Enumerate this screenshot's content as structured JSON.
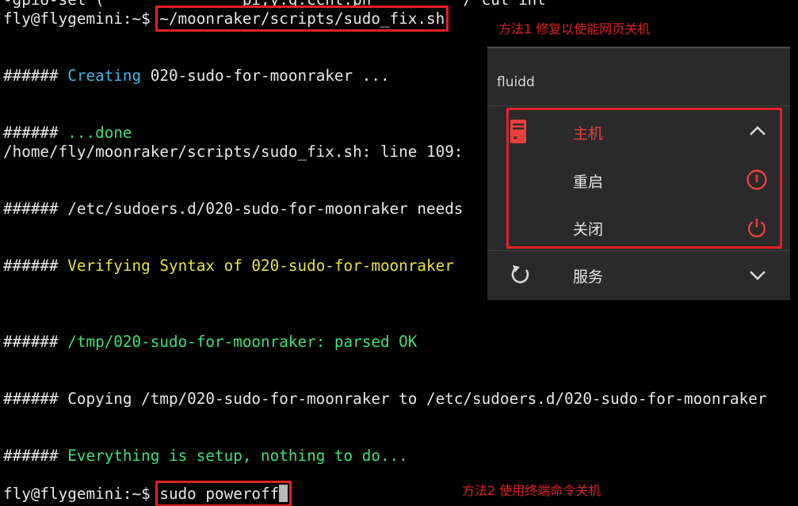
{
  "terminal": {
    "lines": [
      {
        "parts": [
          {
            "t": "-gpio-set (               pi,y.g.ccnt.pn          / cut int",
            "c": "white"
          }
        ]
      },
      {
        "parts": [
          {
            "t": "fly@flygemini:~$ ",
            "c": "white"
          },
          {
            "t": "~/moonraker/scripts/sudo_fix.sh",
            "c": "white",
            "box": true
          }
        ]
      },
      {
        "parts": []
      },
      {
        "parts": []
      },
      {
        "parts": [
          {
            "t": "###### ",
            "c": "white"
          },
          {
            "t": "Creating",
            "c": "cyan"
          },
          {
            "t": " 020-sudo-for-moonraker ...",
            "c": "white"
          }
        ]
      },
      {
        "parts": []
      },
      {
        "parts": []
      },
      {
        "parts": [
          {
            "t": "###### ",
            "c": "white"
          },
          {
            "t": "...done",
            "c": "green"
          }
        ]
      },
      {
        "parts": [
          {
            "t": "/home/fly/moonraker/scripts/sudo_fix.sh: line 109:",
            "c": "white"
          }
        ]
      },
      {
        "parts": []
      },
      {
        "parts": []
      },
      {
        "parts": [
          {
            "t": "###### /etc/sudoers.d/020-sudo-for-moonraker needs",
            "c": "white"
          }
        ]
      },
      {
        "parts": []
      },
      {
        "parts": []
      },
      {
        "parts": [
          {
            "t": "###### ",
            "c": "white"
          },
          {
            "t": "Verifying Syntax of 020-sudo-for-moonraker",
            "c": "yellow"
          }
        ]
      },
      {
        "parts": []
      },
      {
        "parts": []
      },
      {
        "parts": []
      },
      {
        "parts": [
          {
            "t": "###### ",
            "c": "white"
          },
          {
            "t": "/tmp/020-sudo-for-moonraker: parsed OK",
            "c": "green"
          }
        ]
      },
      {
        "parts": []
      },
      {
        "parts": []
      },
      {
        "parts": [
          {
            "t": "###### Copying /tmp/020-sudo-for-moonraker to /etc/sudoers.d/020-sudo-for-moonraker",
            "c": "white"
          }
        ]
      },
      {
        "parts": []
      },
      {
        "parts": []
      },
      {
        "parts": [
          {
            "t": "###### ",
            "c": "white"
          },
          {
            "t": "Everything is setup, nothing to do...",
            "c": "green"
          }
        ]
      },
      {
        "parts": []
      },
      {
        "parts": [
          {
            "t": "fly@flygemini:~$ ",
            "c": "white"
          },
          {
            "t": "sudo poweroff",
            "c": "white",
            "box": true,
            "cursor": true
          }
        ]
      }
    ]
  },
  "annotations": {
    "method1": "方法1 修复以使能网页关机",
    "method2": "方法2 使用终端命令关机"
  },
  "fluidd_menu": {
    "title": "fluidd",
    "host": {
      "label": "主机",
      "icon": "server-icon",
      "chevron": "chevron-up-icon"
    },
    "reboot": {
      "label": "重启",
      "icon": "restart-icon"
    },
    "shutdown": {
      "label": "关闭",
      "icon": "power-icon"
    },
    "services": {
      "label": "服务",
      "icon": "refresh-icon",
      "chevron": "chevron-down-icon"
    }
  },
  "colors": {
    "accent_red": "#e0202a",
    "menu_active": "#e8403f",
    "terminal_cyan": "#3fb8e8",
    "terminal_green": "#3ee07a",
    "terminal_yellow": "#e8e347"
  }
}
